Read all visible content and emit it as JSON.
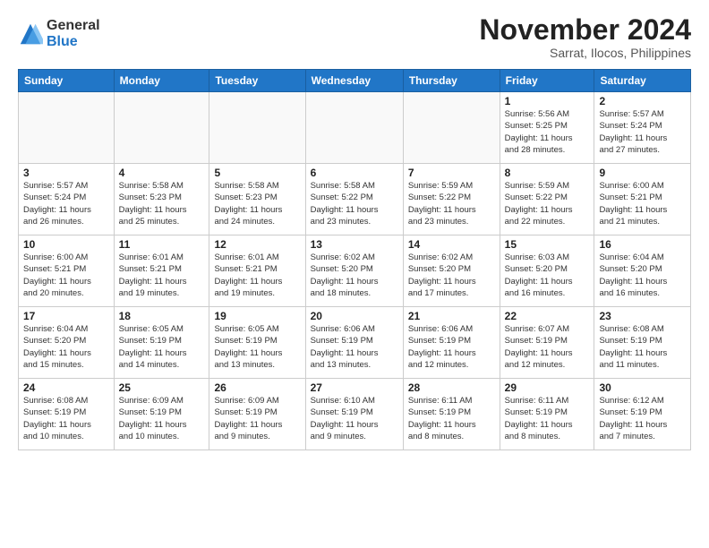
{
  "logo": {
    "general": "General",
    "blue": "Blue"
  },
  "title": "November 2024",
  "subtitle": "Sarrat, Ilocos, Philippines",
  "weekdays": [
    "Sunday",
    "Monday",
    "Tuesday",
    "Wednesday",
    "Thursday",
    "Friday",
    "Saturday"
  ],
  "weeks": [
    [
      {
        "day": "",
        "info": ""
      },
      {
        "day": "",
        "info": ""
      },
      {
        "day": "",
        "info": ""
      },
      {
        "day": "",
        "info": ""
      },
      {
        "day": "",
        "info": ""
      },
      {
        "day": "1",
        "info": "Sunrise: 5:56 AM\nSunset: 5:25 PM\nDaylight: 11 hours\nand 28 minutes."
      },
      {
        "day": "2",
        "info": "Sunrise: 5:57 AM\nSunset: 5:24 PM\nDaylight: 11 hours\nand 27 minutes."
      }
    ],
    [
      {
        "day": "3",
        "info": "Sunrise: 5:57 AM\nSunset: 5:24 PM\nDaylight: 11 hours\nand 26 minutes."
      },
      {
        "day": "4",
        "info": "Sunrise: 5:58 AM\nSunset: 5:23 PM\nDaylight: 11 hours\nand 25 minutes."
      },
      {
        "day": "5",
        "info": "Sunrise: 5:58 AM\nSunset: 5:23 PM\nDaylight: 11 hours\nand 24 minutes."
      },
      {
        "day": "6",
        "info": "Sunrise: 5:58 AM\nSunset: 5:22 PM\nDaylight: 11 hours\nand 23 minutes."
      },
      {
        "day": "7",
        "info": "Sunrise: 5:59 AM\nSunset: 5:22 PM\nDaylight: 11 hours\nand 23 minutes."
      },
      {
        "day": "8",
        "info": "Sunrise: 5:59 AM\nSunset: 5:22 PM\nDaylight: 11 hours\nand 22 minutes."
      },
      {
        "day": "9",
        "info": "Sunrise: 6:00 AM\nSunset: 5:21 PM\nDaylight: 11 hours\nand 21 minutes."
      }
    ],
    [
      {
        "day": "10",
        "info": "Sunrise: 6:00 AM\nSunset: 5:21 PM\nDaylight: 11 hours\nand 20 minutes."
      },
      {
        "day": "11",
        "info": "Sunrise: 6:01 AM\nSunset: 5:21 PM\nDaylight: 11 hours\nand 19 minutes."
      },
      {
        "day": "12",
        "info": "Sunrise: 6:01 AM\nSunset: 5:21 PM\nDaylight: 11 hours\nand 19 minutes."
      },
      {
        "day": "13",
        "info": "Sunrise: 6:02 AM\nSunset: 5:20 PM\nDaylight: 11 hours\nand 18 minutes."
      },
      {
        "day": "14",
        "info": "Sunrise: 6:02 AM\nSunset: 5:20 PM\nDaylight: 11 hours\nand 17 minutes."
      },
      {
        "day": "15",
        "info": "Sunrise: 6:03 AM\nSunset: 5:20 PM\nDaylight: 11 hours\nand 16 minutes."
      },
      {
        "day": "16",
        "info": "Sunrise: 6:04 AM\nSunset: 5:20 PM\nDaylight: 11 hours\nand 16 minutes."
      }
    ],
    [
      {
        "day": "17",
        "info": "Sunrise: 6:04 AM\nSunset: 5:20 PM\nDaylight: 11 hours\nand 15 minutes."
      },
      {
        "day": "18",
        "info": "Sunrise: 6:05 AM\nSunset: 5:19 PM\nDaylight: 11 hours\nand 14 minutes."
      },
      {
        "day": "19",
        "info": "Sunrise: 6:05 AM\nSunset: 5:19 PM\nDaylight: 11 hours\nand 13 minutes."
      },
      {
        "day": "20",
        "info": "Sunrise: 6:06 AM\nSunset: 5:19 PM\nDaylight: 11 hours\nand 13 minutes."
      },
      {
        "day": "21",
        "info": "Sunrise: 6:06 AM\nSunset: 5:19 PM\nDaylight: 11 hours\nand 12 minutes."
      },
      {
        "day": "22",
        "info": "Sunrise: 6:07 AM\nSunset: 5:19 PM\nDaylight: 11 hours\nand 12 minutes."
      },
      {
        "day": "23",
        "info": "Sunrise: 6:08 AM\nSunset: 5:19 PM\nDaylight: 11 hours\nand 11 minutes."
      }
    ],
    [
      {
        "day": "24",
        "info": "Sunrise: 6:08 AM\nSunset: 5:19 PM\nDaylight: 11 hours\nand 10 minutes."
      },
      {
        "day": "25",
        "info": "Sunrise: 6:09 AM\nSunset: 5:19 PM\nDaylight: 11 hours\nand 10 minutes."
      },
      {
        "day": "26",
        "info": "Sunrise: 6:09 AM\nSunset: 5:19 PM\nDaylight: 11 hours\nand 9 minutes."
      },
      {
        "day": "27",
        "info": "Sunrise: 6:10 AM\nSunset: 5:19 PM\nDaylight: 11 hours\nand 9 minutes."
      },
      {
        "day": "28",
        "info": "Sunrise: 6:11 AM\nSunset: 5:19 PM\nDaylight: 11 hours\nand 8 minutes."
      },
      {
        "day": "29",
        "info": "Sunrise: 6:11 AM\nSunset: 5:19 PM\nDaylight: 11 hours\nand 8 minutes."
      },
      {
        "day": "30",
        "info": "Sunrise: 6:12 AM\nSunset: 5:19 PM\nDaylight: 11 hours\nand 7 minutes."
      }
    ]
  ]
}
